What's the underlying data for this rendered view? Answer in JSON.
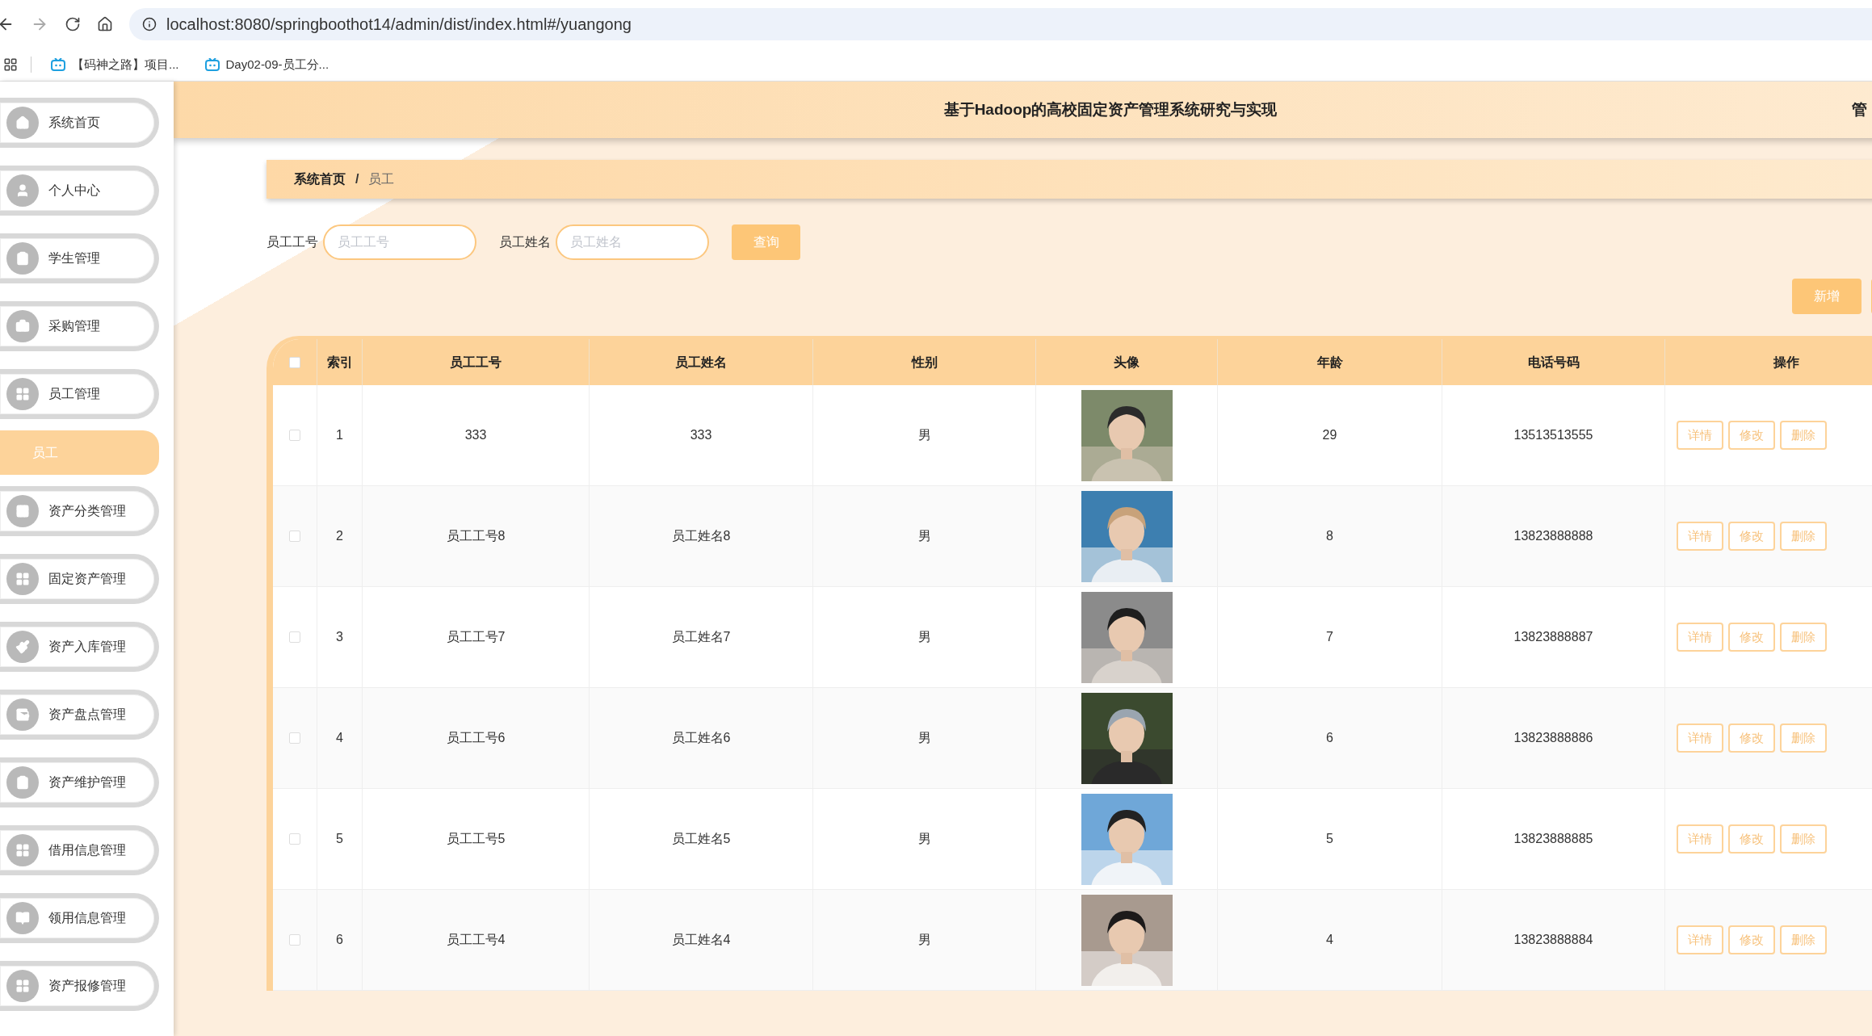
{
  "browser": {
    "url": "localhost:8080/springboothot14/admin/dist/index.html#/yuangong",
    "bookmarks": [
      "【码神之路】项目...",
      "Day02-09-员工分..."
    ]
  },
  "header": {
    "title": "基于Hadoop的高校固定资产管理系统研究与实现",
    "user_text": "管"
  },
  "sidebar": {
    "items": [
      {
        "label": "系统首页"
      },
      {
        "label": "个人中心"
      },
      {
        "label": "学生管理"
      },
      {
        "label": "采购管理"
      },
      {
        "label": "员工管理",
        "children": [
          {
            "label": "员工",
            "selected": true
          }
        ]
      },
      {
        "label": "资产分类管理"
      },
      {
        "label": "固定资产管理"
      },
      {
        "label": "资产入库管理"
      },
      {
        "label": "资产盘点管理"
      },
      {
        "label": "资产维护管理"
      },
      {
        "label": "借用信息管理"
      },
      {
        "label": "领用信息管理"
      },
      {
        "label": "资产报修管理"
      }
    ]
  },
  "breadcrumb": {
    "items": [
      "系统首页",
      "员工"
    ],
    "separator": "/"
  },
  "search": {
    "fields": [
      {
        "label": "员工工号",
        "placeholder": "员工工号"
      },
      {
        "label": "员工姓名",
        "placeholder": "员工姓名"
      }
    ],
    "button": "查询"
  },
  "toolbar": {
    "buttons": [
      "新增"
    ]
  },
  "table": {
    "select_all_checked": false,
    "columns": [
      "索引",
      "员工工号",
      "员工姓名",
      "性别",
      "头像",
      "年龄",
      "电话号码",
      "操作"
    ],
    "rows": [
      {
        "checked": false,
        "index": "1",
        "id": "333",
        "name": "333",
        "gender": "男",
        "age": "29",
        "phone": "13513513555",
        "actions": [
          "详情",
          "修改",
          "删除"
        ]
      },
      {
        "checked": false,
        "index": "2",
        "id": "员工工号8",
        "name": "员工姓名8",
        "gender": "男",
        "age": "8",
        "phone": "13823888888",
        "actions": [
          "详情",
          "修改",
          "删除"
        ]
      },
      {
        "checked": false,
        "index": "3",
        "id": "员工工号7",
        "name": "员工姓名7",
        "gender": "男",
        "age": "7",
        "phone": "13823888887",
        "actions": [
          "详情",
          "修改",
          "删除"
        ]
      },
      {
        "checked": false,
        "index": "4",
        "id": "员工工号6",
        "name": "员工姓名6",
        "gender": "男",
        "age": "6",
        "phone": "13823888886",
        "actions": [
          "详情",
          "修改",
          "删除"
        ]
      },
      {
        "checked": false,
        "index": "5",
        "id": "员工工号5",
        "name": "员工姓名5",
        "gender": "男",
        "age": "5",
        "phone": "13823888885",
        "actions": [
          "详情",
          "修改",
          "删除"
        ]
      },
      {
        "checked": false,
        "index": "6",
        "id": "员工工号4",
        "name": "员工姓名4",
        "gender": "男",
        "age": "4",
        "phone": "13823888884",
        "actions": [
          "详情",
          "修改",
          "删除"
        ]
      }
    ]
  }
}
